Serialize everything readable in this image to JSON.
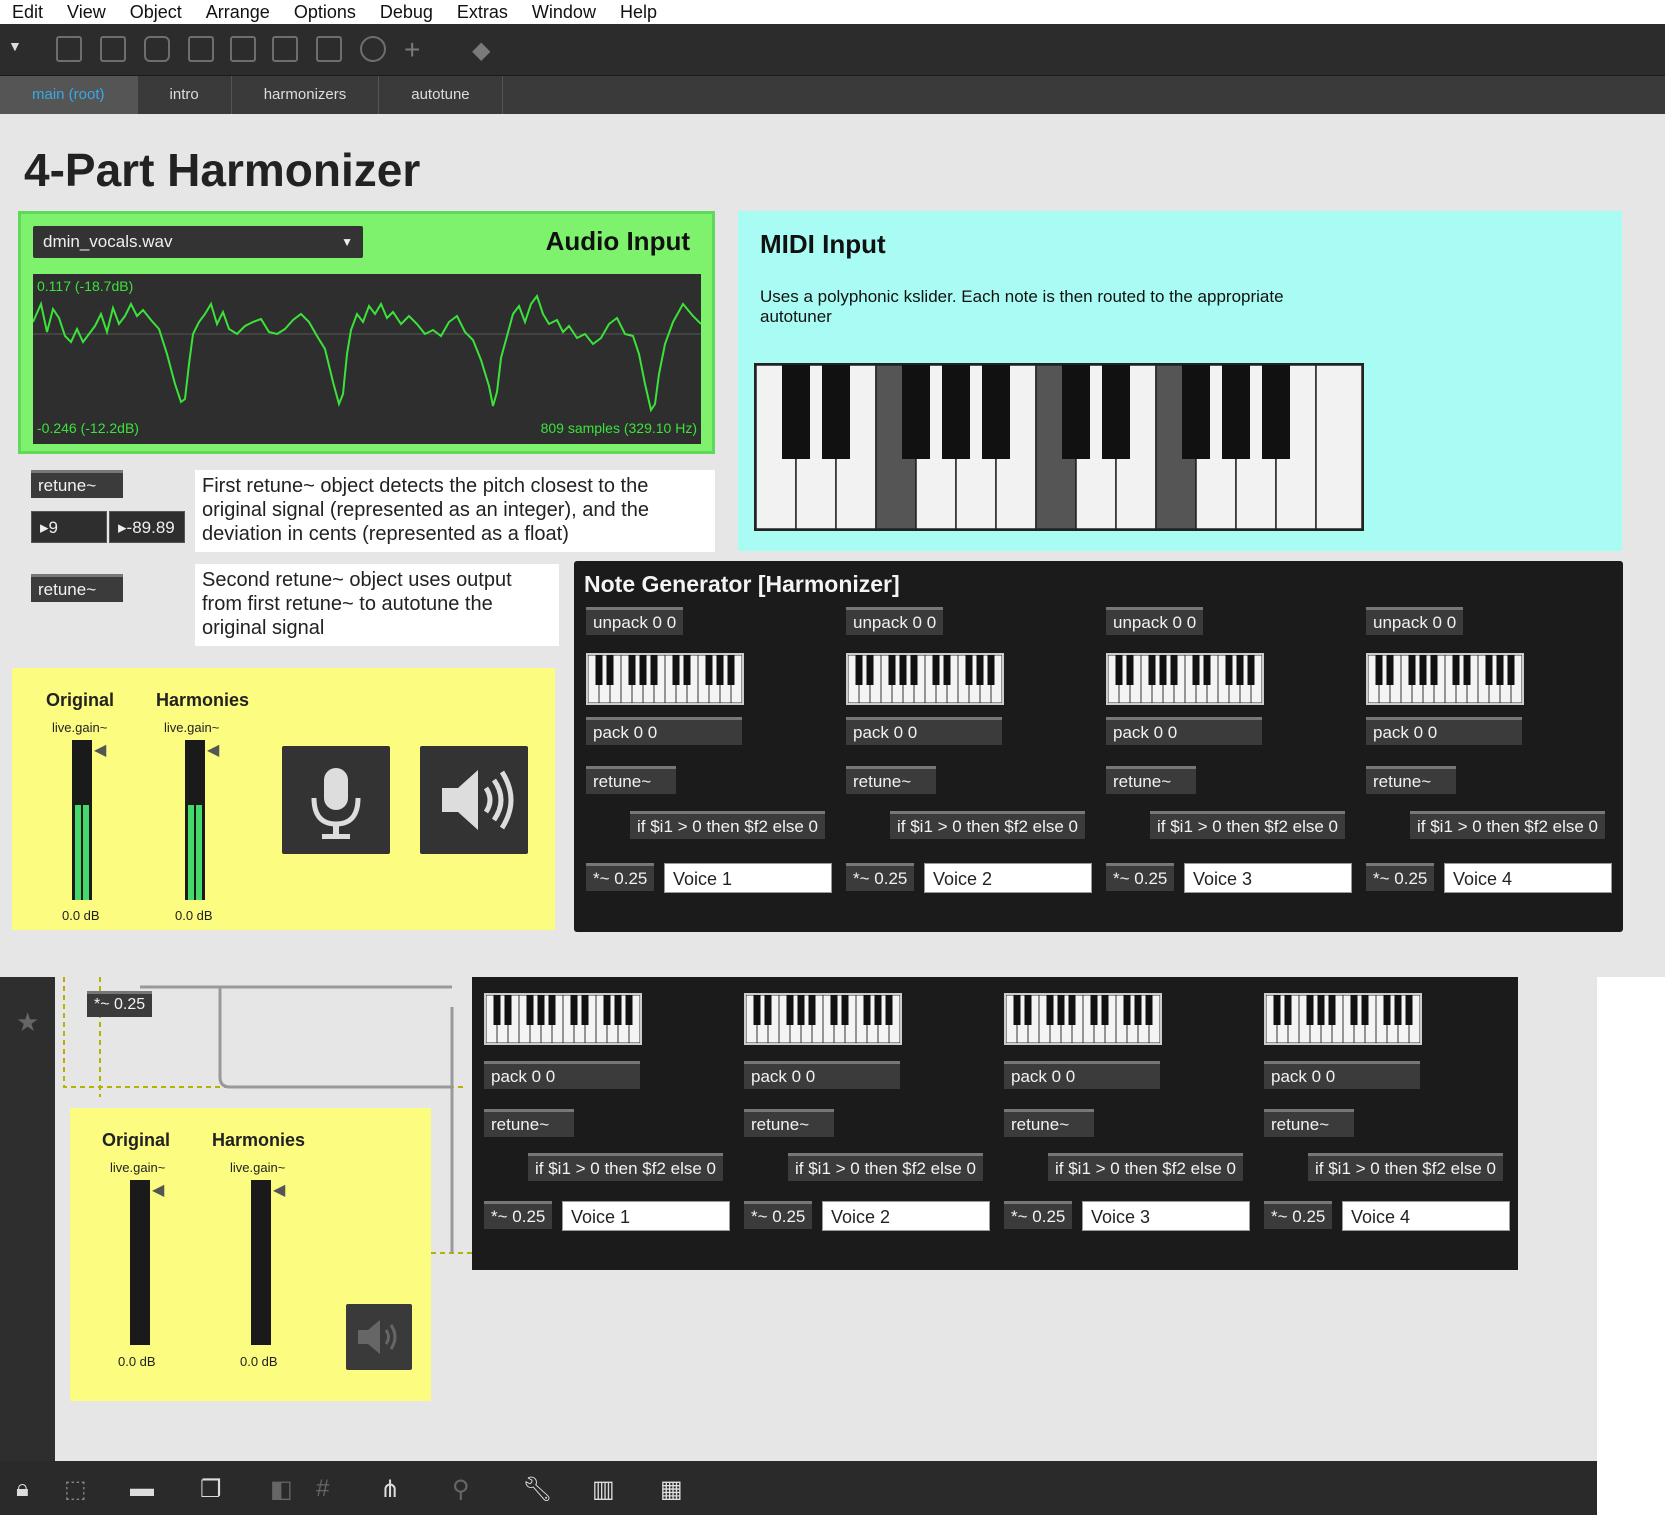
{
  "menu": [
    "Edit",
    "View",
    "Object",
    "Arrange",
    "Options",
    "Debug",
    "Extras",
    "Window",
    "Help"
  ],
  "tabs": [
    {
      "label": "main (root)",
      "active": true
    },
    {
      "label": "intro",
      "active": false
    },
    {
      "label": "harmonizers",
      "active": false
    },
    {
      "label": "autotune",
      "active": false
    }
  ],
  "page_title": "4-Part Harmonizer",
  "audio_input": {
    "title": "Audio Input",
    "file": "dmin_vocals.wav",
    "scope_top": "0.117 (-18.7dB)",
    "scope_bottom": "-0.246 (-12.2dB)",
    "scope_info": "809 samples (329.10 Hz)"
  },
  "retune1": {
    "label": "retune~",
    "pitch": "9",
    "cents": "-89.89",
    "comment": "First retune~ object detects the pitch closest to the original signal (represented as an integer), and the deviation in cents (represented as a float)"
  },
  "retune2": {
    "label": "retune~",
    "comment": "Second retune~ object uses output from first retune~ to autotune the original signal"
  },
  "midi_input": {
    "title": "MIDI Input",
    "description": "Uses a polyphonic kslider. Each note is then routed to the appropriate autotuner"
  },
  "gain": {
    "original_label": "Original",
    "harmonies_label": "Harmonies",
    "sub_label": "live.gain~",
    "original_db": "0.0 dB",
    "harmonies_db": "0.0 dB"
  },
  "note_generator": {
    "title": "Note Generator [Harmonizer]",
    "voices": [
      {
        "unpack": "unpack 0 0",
        "pack": "pack 0 0",
        "retune": "retune~",
        "expr": "if $i1 > 0 then $f2 else 0",
        "mult": "*~ 0.25",
        "name": "Voice 1"
      },
      {
        "unpack": "unpack 0 0",
        "pack": "pack 0 0",
        "retune": "retune~",
        "expr": "if $i1 > 0 then $f2 else 0",
        "mult": "*~ 0.25",
        "name": "Voice 2"
      },
      {
        "unpack": "unpack 0 0",
        "pack": "pack 0 0",
        "retune": "retune~",
        "expr": "if $i1 > 0 then $f2 else 0",
        "mult": "*~ 0.25",
        "name": "Voice 3"
      },
      {
        "unpack": "unpack 0 0",
        "pack": "pack 0 0",
        "retune": "retune~",
        "expr": "if $i1 > 0 then $f2 else 0",
        "mult": "*~ 0.25",
        "name": "Voice 4"
      }
    ]
  },
  "editor": {
    "mult": "*~ 0.25",
    "original_label": "Original",
    "harmonies_label": "Harmonies",
    "sub_label": "live.gain~",
    "original_db": "0.0 dB",
    "harmonies_db": "0.0 dB"
  },
  "colors": {
    "audio_panel": "#7ef26c",
    "midi_panel": "#a8fcf3",
    "gain_panel": "#fcfc80",
    "scope_line": "#3ae23a",
    "active_tab_text": "#39a9e8"
  },
  "icons": [
    "lock-icon",
    "select-icon",
    "presentation-icon",
    "window-icon",
    "hide-icon",
    "grid-icon",
    "hierarchy-icon",
    "link-icon",
    "wrench-icon",
    "piano-icon",
    "keyboard-icon",
    "star-icon",
    "microphone-icon",
    "speaker-icon"
  ]
}
